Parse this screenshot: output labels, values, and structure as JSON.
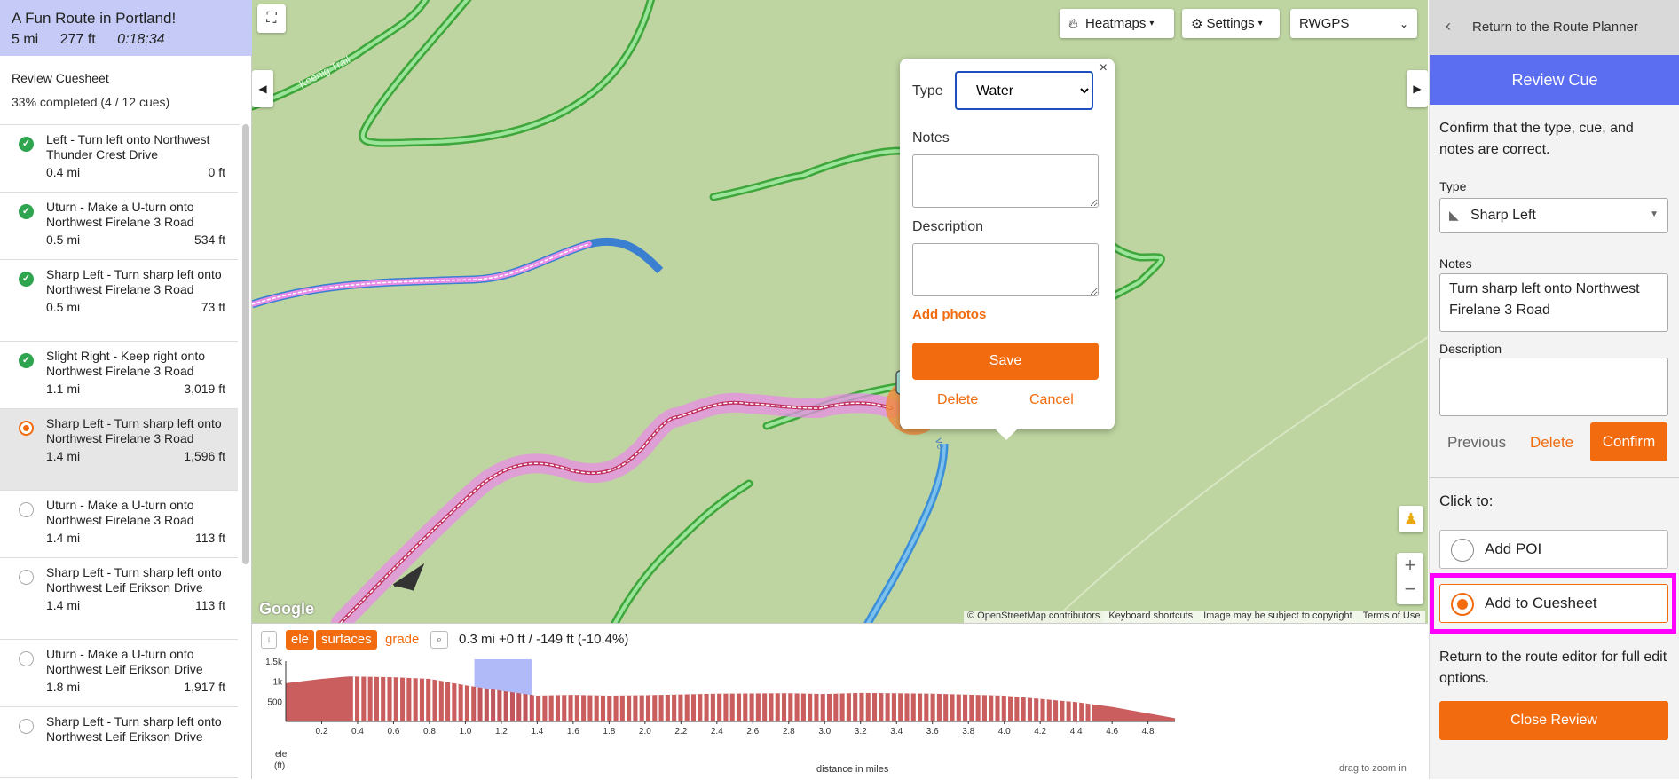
{
  "route": {
    "title": "A Fun Route in Portland!",
    "distance": "5 mi",
    "elevation": "277 ft",
    "duration": "0:18:34"
  },
  "review": {
    "title": "Review Cuesheet",
    "progress": "33% completed (4 / 12 cues)"
  },
  "cues": [
    {
      "text": "Left - Turn left onto Northwest Thunder Crest Drive",
      "dist": "0.4 mi",
      "elev": "0 ft",
      "status": "done"
    },
    {
      "text": "Uturn - Make a U-turn onto Northwest Firelane 3 Road",
      "dist": "0.5 mi",
      "elev": "534 ft",
      "status": "done"
    },
    {
      "text": "Sharp Left - Turn sharp left onto Northwest Firelane 3 Road",
      "dist": "0.5 mi",
      "elev": "73 ft",
      "status": "done"
    },
    {
      "text": "Slight Right - Keep right onto Northwest Firelane 3 Road",
      "dist": "1.1 mi",
      "elev": "3,019 ft",
      "status": "done"
    },
    {
      "text": "Sharp Left - Turn sharp left onto Northwest Firelane 3 Road",
      "dist": "1.4 mi",
      "elev": "1,596 ft",
      "status": "current"
    },
    {
      "text": "Uturn - Make a U-turn onto Northwest Firelane 3 Road",
      "dist": "1.4 mi",
      "elev": "113 ft",
      "status": "pending"
    },
    {
      "text": "Sharp Left - Turn sharp left onto Northwest Leif Erikson Drive",
      "dist": "1.4 mi",
      "elev": "113 ft",
      "status": "pending"
    },
    {
      "text": "Uturn - Make a U-turn onto Northwest Leif Erikson Drive",
      "dist": "1.8 mi",
      "elev": "1,917 ft",
      "status": "pending"
    },
    {
      "text": "Sharp Left - Turn sharp left onto Northwest Leif Erikson Drive",
      "dist": "",
      "elev": "",
      "status": "pending"
    }
  ],
  "map": {
    "heatmaps": "Heatmaps",
    "settings": "Settings",
    "layer": "RWGPS",
    "trail_label": "Koenig Trail",
    "attribution": "© OpenStreetMap contributors",
    "shortcuts": "Keyboard shortcuts",
    "copyright": "Image may be subject to copyright",
    "terms": "Terms of Use",
    "google": "Google"
  },
  "popup": {
    "type_label": "Type",
    "type_value": "Water",
    "notes_label": "Notes",
    "description_label": "Description",
    "add_photos": "Add photos",
    "save": "Save",
    "delete": "Delete",
    "cancel": "Cancel"
  },
  "elevation": {
    "tag_ele": "ele",
    "tag_surfaces": "surfaces",
    "tag_grade": "grade",
    "readout": "0.3 mi +0 ft / -149 ft (-10.4%)",
    "y_unit_label": "ele",
    "y_unit": "(ft)",
    "x_label": "distance in miles",
    "drag_hint": "drag to zoom in",
    "y_ticks": [
      "1.5k",
      "1k",
      "500"
    ],
    "x_ticks": [
      "0.2",
      "0.4",
      "0.6",
      "0.8",
      "1.0",
      "1.2",
      "1.4",
      "1.6",
      "1.8",
      "2.0",
      "2.2",
      "2.4",
      "2.6",
      "2.8",
      "3.0",
      "3.2",
      "3.4",
      "3.6",
      "3.8",
      "4.0",
      "4.2",
      "4.4",
      "4.6",
      "4.8"
    ]
  },
  "chart_data": {
    "type": "area",
    "xlabel": "distance in miles",
    "ylabel": "ele (ft)",
    "ylim": [
      0,
      1500
    ],
    "xlim": [
      0,
      4.95
    ],
    "x": [
      0,
      0.2,
      0.35,
      0.6,
      0.8,
      1.0,
      1.2,
      1.4,
      1.6,
      1.8,
      2.0,
      2.4,
      2.8,
      3.0,
      3.2,
      3.6,
      4.0,
      4.4,
      4.6,
      4.8,
      4.95
    ],
    "series": [
      {
        "values": [
          950,
          1060,
          1120,
          1100,
          1060,
          900,
          760,
          640,
          660,
          640,
          650,
          690,
          700,
          680,
          710,
          690,
          640,
          480,
          360,
          200,
          80
        ]
      }
    ],
    "highlight_range": [
      1.05,
      1.37
    ]
  },
  "panel": {
    "return": "Return to the Route Planner",
    "header": "Review Cue",
    "instructions": "Confirm that the type, cue, and notes are correct.",
    "type_label": "Type",
    "type_value": "Sharp Left",
    "notes_label": "Notes",
    "notes_value": "Turn sharp left onto Northwest Firelane 3 Road",
    "description_label": "Description",
    "previous": "Previous",
    "delete": "Delete",
    "confirm": "Confirm",
    "click_to": "Click to:",
    "add_poi": "Add POI",
    "add_cuesheet": "Add to Cuesheet",
    "footer": "Return to the route editor for full edit options.",
    "close_review": "Close Review"
  },
  "colors": {
    "accent": "#f26b0f",
    "header_blue": "#5b6ef2",
    "route_pink": "#e88ee6",
    "highlight": "#ff00ff"
  }
}
